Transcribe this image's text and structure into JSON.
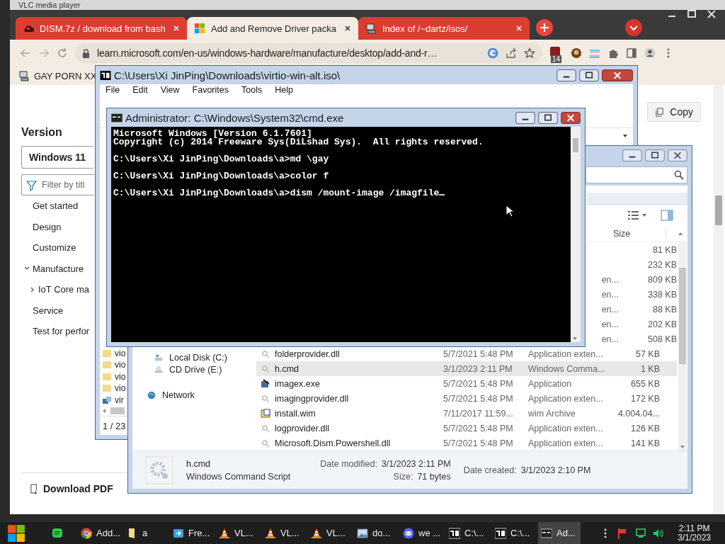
{
  "background_window": {
    "title": "VLC media player"
  },
  "browser": {
    "tabs": [
      {
        "title": "DISM.7z / download from bash",
        "selected": false,
        "kind": "cloud"
      },
      {
        "title": "Add and Remove Driver packa",
        "selected": true,
        "kind": "windows"
      },
      {
        "title": "Index of /~dartz/isos/",
        "selected": false,
        "kind": "computer"
      }
    ],
    "url": "learn.microsoft.com/en-us/windows-hardware/manufacture/desktop/add-and-r…",
    "extension_badge": "14",
    "bookmarks": [
      {
        "label": "GAY PORN XX"
      }
    ],
    "sidebar": {
      "heading": "Version",
      "version_select": "Windows 11",
      "filter_placeholder": "Filter by titl",
      "nav": [
        {
          "label": "Get started"
        },
        {
          "label": "Design"
        },
        {
          "label": "Customize"
        },
        {
          "label": "Manufacture",
          "expanded": true,
          "children": [
            {
              "label": "IoT Core ma",
              "expanded": false
            }
          ]
        },
        {
          "label": "Service"
        },
        {
          "label": "Test for perfor"
        }
      ],
      "download": "Download PDF"
    },
    "copy_button": "Copy"
  },
  "sevenzip": {
    "title": "C:\\Users\\Xi JinPing\\Downloads\\virtio-win-alt.iso\\",
    "menu": [
      "File",
      "Edit",
      "View",
      "Favorites",
      "Tools",
      "Help"
    ],
    "items": [
      {
        "name": "vio",
        "kind": "folder"
      },
      {
        "name": "vio",
        "kind": "folder"
      },
      {
        "name": "vio",
        "kind": "folder"
      },
      {
        "name": "vio",
        "kind": "folder"
      },
      {
        "name": "vir",
        "kind": "installer"
      }
    ],
    "status": "1 / 23"
  },
  "explorer": {
    "size_header": "Size",
    "nav": [
      {
        "label": "Local Disk (C:)",
        "kind": "drive"
      },
      {
        "label": "CD Drive (E:)",
        "kind": "cd"
      },
      {
        "label": "Network",
        "kind": "network"
      }
    ],
    "rows": [
      {
        "size": "81 KB",
        "selected": false
      },
      {
        "size": "232 KB",
        "selected": false
      },
      {
        "type": "en...",
        "size": "809 KB",
        "selected": false
      },
      {
        "type": "en...",
        "size": "338 KB",
        "selected": false
      },
      {
        "type": "en...",
        "size": "88 KB",
        "selected": false
      },
      {
        "type": "en...",
        "size": "202 KB",
        "selected": false
      },
      {
        "type": "en...",
        "size": "508 KB",
        "selected": false
      },
      {
        "name": "folderprovider.dll",
        "kind": "dll",
        "date": "5/7/2021 5:48 PM",
        "type": "Application exten...",
        "size": "57 KB",
        "selected": false
      },
      {
        "name": "h.cmd",
        "kind": "dll",
        "date": "3/1/2023 2:11 PM",
        "type": "Windows Comma...",
        "size": "1 KB",
        "selected": true
      },
      {
        "name": "imagex.exe",
        "kind": "exe",
        "date": "5/7/2021 5:48 PM",
        "type": "Application",
        "size": "655 KB",
        "selected": false
      },
      {
        "name": "imagingprovider.dll",
        "kind": "dll",
        "date": "5/7/2021 5:48 PM",
        "type": "Application exten...",
        "size": "172 KB",
        "selected": false
      },
      {
        "name": "install.wim",
        "kind": "wim",
        "date": "7/11/2017 11:59...",
        "type": "wim Archive",
        "size": "4.004.04...",
        "selected": false
      },
      {
        "name": "logprovider.dll",
        "kind": "dll",
        "date": "5/7/2021 5:48 PM",
        "type": "Application exten...",
        "size": "126 KB",
        "selected": false
      },
      {
        "name": "Microsoft.Dism.Powershell.dll",
        "kind": "dll",
        "date": "5/7/2021 5:48 PM",
        "type": "Application exten...",
        "size": "141 KB",
        "selected": false
      }
    ],
    "details": {
      "name": "h.cmd",
      "type": "Windows Command Script",
      "modified_label": "Date modified:",
      "modified": "3/1/2023 2:11 PM",
      "size_label": "Size:",
      "size": "71 bytes",
      "created_label": "Date created:",
      "created": "3/1/2023 2:10 PM"
    }
  },
  "cmd": {
    "title": "Administrator: C:\\Windows\\System32\\cmd.exe",
    "lines": [
      {
        "kind": "banner",
        "text": "Microsoft Windows [Version 6.1.7601]"
      },
      {
        "kind": "banner",
        "text": "Copyright (c) 2014 Freeware Sys(DiLshad Sys).  All rights reserved."
      },
      {
        "kind": "prompt",
        "text": "C:\\Users\\Xi JinPing\\Downloads\\a>md \\gay"
      },
      {
        "kind": "prompt",
        "text": "C:\\Users\\Xi JinPing\\Downloads\\a>color f"
      },
      {
        "kind": "prompt",
        "text": "C:\\Users\\Xi JinPing\\Downloads\\a>dism /mount-image /imagfile"
      }
    ]
  },
  "taskbar": {
    "items": [
      {
        "kind": "chat",
        "selected": false
      },
      {
        "kind": "chrome",
        "label": "Add...",
        "selected": false
      },
      {
        "kind": "folder",
        "label": "a",
        "selected": false
      },
      {
        "kind": "remote",
        "label": "Fre...",
        "selected": false
      },
      {
        "kind": "cone",
        "label": "VL...",
        "selected": false
      },
      {
        "kind": "cone",
        "label": "VL...",
        "selected": false
      },
      {
        "kind": "cone",
        "label": "VL...",
        "selected": false
      },
      {
        "kind": "image",
        "label": "do...",
        "selected": false
      },
      {
        "kind": "discord",
        "label": "we ...",
        "selected": false
      },
      {
        "kind": "archive",
        "label": "C:\\...",
        "selected": false
      },
      {
        "kind": "archive",
        "label": "C:\\...",
        "selected": false
      },
      {
        "kind": "console",
        "label": "Ad...",
        "selected": true
      }
    ],
    "time": "2:11 PM",
    "date": "3/1/2023"
  }
}
